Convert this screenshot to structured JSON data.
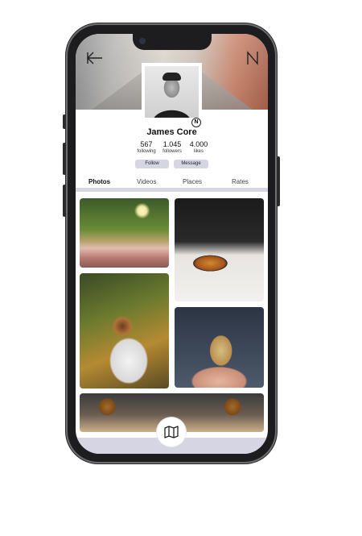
{
  "profile": {
    "name": "James Core",
    "badge_letter": "N",
    "stats": [
      {
        "value": "567",
        "label": "following"
      },
      {
        "value": "1.045",
        "label": "followers"
      },
      {
        "value": "4.000",
        "label": "likes"
      }
    ],
    "actions": {
      "follow": "Follow",
      "message": "Message"
    }
  },
  "tabs": [
    {
      "label": "Photos",
      "active": true
    },
    {
      "label": "Videos",
      "active": false
    },
    {
      "label": "Places",
      "active": false
    },
    {
      "label": "Rates",
      "active": false
    }
  ],
  "icons": {
    "back": "arrow-left-icon",
    "brand": "brand-n-icon",
    "map": "map-icon"
  },
  "colors": {
    "accent": "#d6d5e4",
    "phone_frame": "#1d1d1f",
    "text": "#111111"
  }
}
